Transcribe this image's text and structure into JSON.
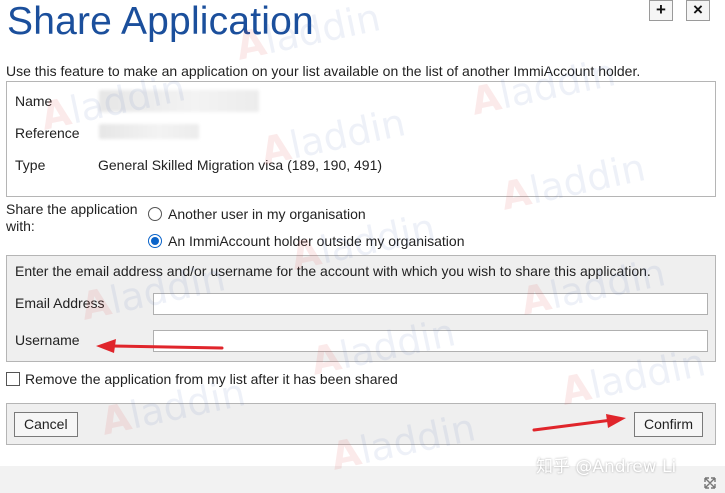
{
  "dialog": {
    "title": "Share Application",
    "intro": "Use this feature to make an application on your list available on the list of another ImmiAccount holder.",
    "buttons": {
      "expand": "+",
      "close": "×"
    }
  },
  "application": {
    "name_label": "Name",
    "reference_label": "Reference",
    "type_label": "Type",
    "type_value": "General Skilled Migration visa (189, 190, 491)"
  },
  "share": {
    "label": "Share the application with:",
    "options": [
      {
        "label": "Another user in my organisation",
        "selected": false
      },
      {
        "label": "An ImmiAccount holder outside my organisation",
        "selected": true
      }
    ]
  },
  "email_section": {
    "intro": "Enter the email address and/or username for the account with which you wish to share this application.",
    "email_label": "Email Address",
    "email_value": "",
    "username_label": "Username",
    "username_value": ""
  },
  "remove_option": {
    "label": "Remove the application from my list after it has been shared",
    "checked": false
  },
  "footer": {
    "cancel_label": "Cancel",
    "confirm_label": "Confirm"
  },
  "watermark": {
    "text_a": "A",
    "text": "laddin",
    "credit": "知乎 @Andrew Li"
  },
  "colors": {
    "title": "#1b4f9c",
    "radio_selected": "#0a63c9",
    "annotation_arrow": "#e0252b"
  }
}
